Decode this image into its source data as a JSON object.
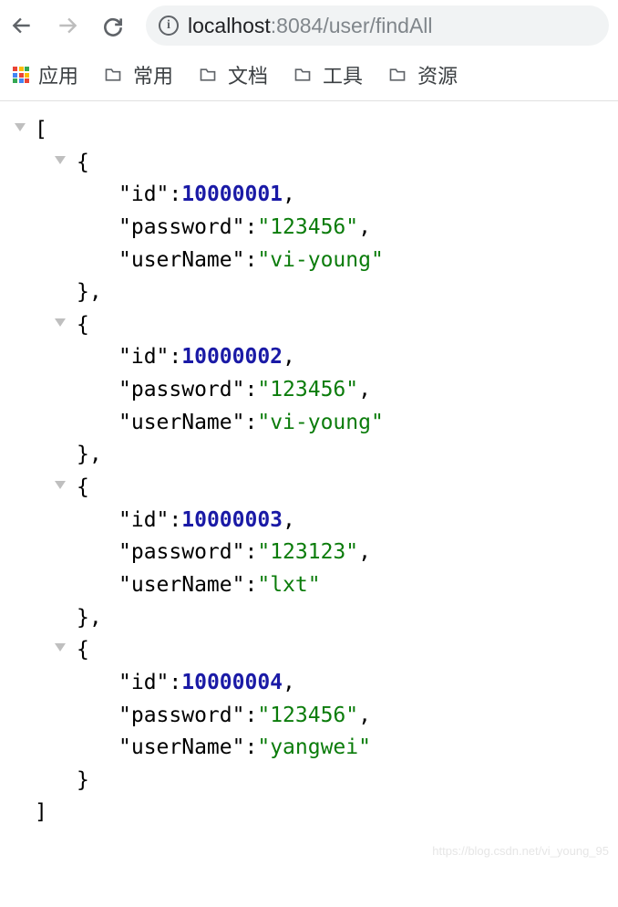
{
  "url": {
    "host": "localhost",
    "port": ":8084",
    "path": "/user/findAll"
  },
  "bookmarks": {
    "apps_label": "应用",
    "items": [
      {
        "label": "常用"
      },
      {
        "label": "文档"
      },
      {
        "label": "工具"
      },
      {
        "label": "资源"
      }
    ]
  },
  "json": {
    "keys": {
      "id": "\"id\"",
      "password": "\"password\"",
      "userName": "\"userName\""
    },
    "items": [
      {
        "id": "10000001",
        "password": "\"123456\"",
        "userName": "\"vi-young\""
      },
      {
        "id": "10000002",
        "password": "\"123456\"",
        "userName": "\"vi-young\""
      },
      {
        "id": "10000003",
        "password": "\"123123\"",
        "userName": "\"lxt\""
      },
      {
        "id": "10000004",
        "password": "\"123456\"",
        "userName": "\"yangwei\""
      }
    ]
  },
  "watermark": "https://blog.csdn.net/vi_young_95",
  "apps_colors": [
    "#ea4335",
    "#fbbc04",
    "#34a853",
    "#4285f4",
    "#ea4335",
    "#fbbc04",
    "#34a853",
    "#4285f4",
    "#ea4335"
  ]
}
